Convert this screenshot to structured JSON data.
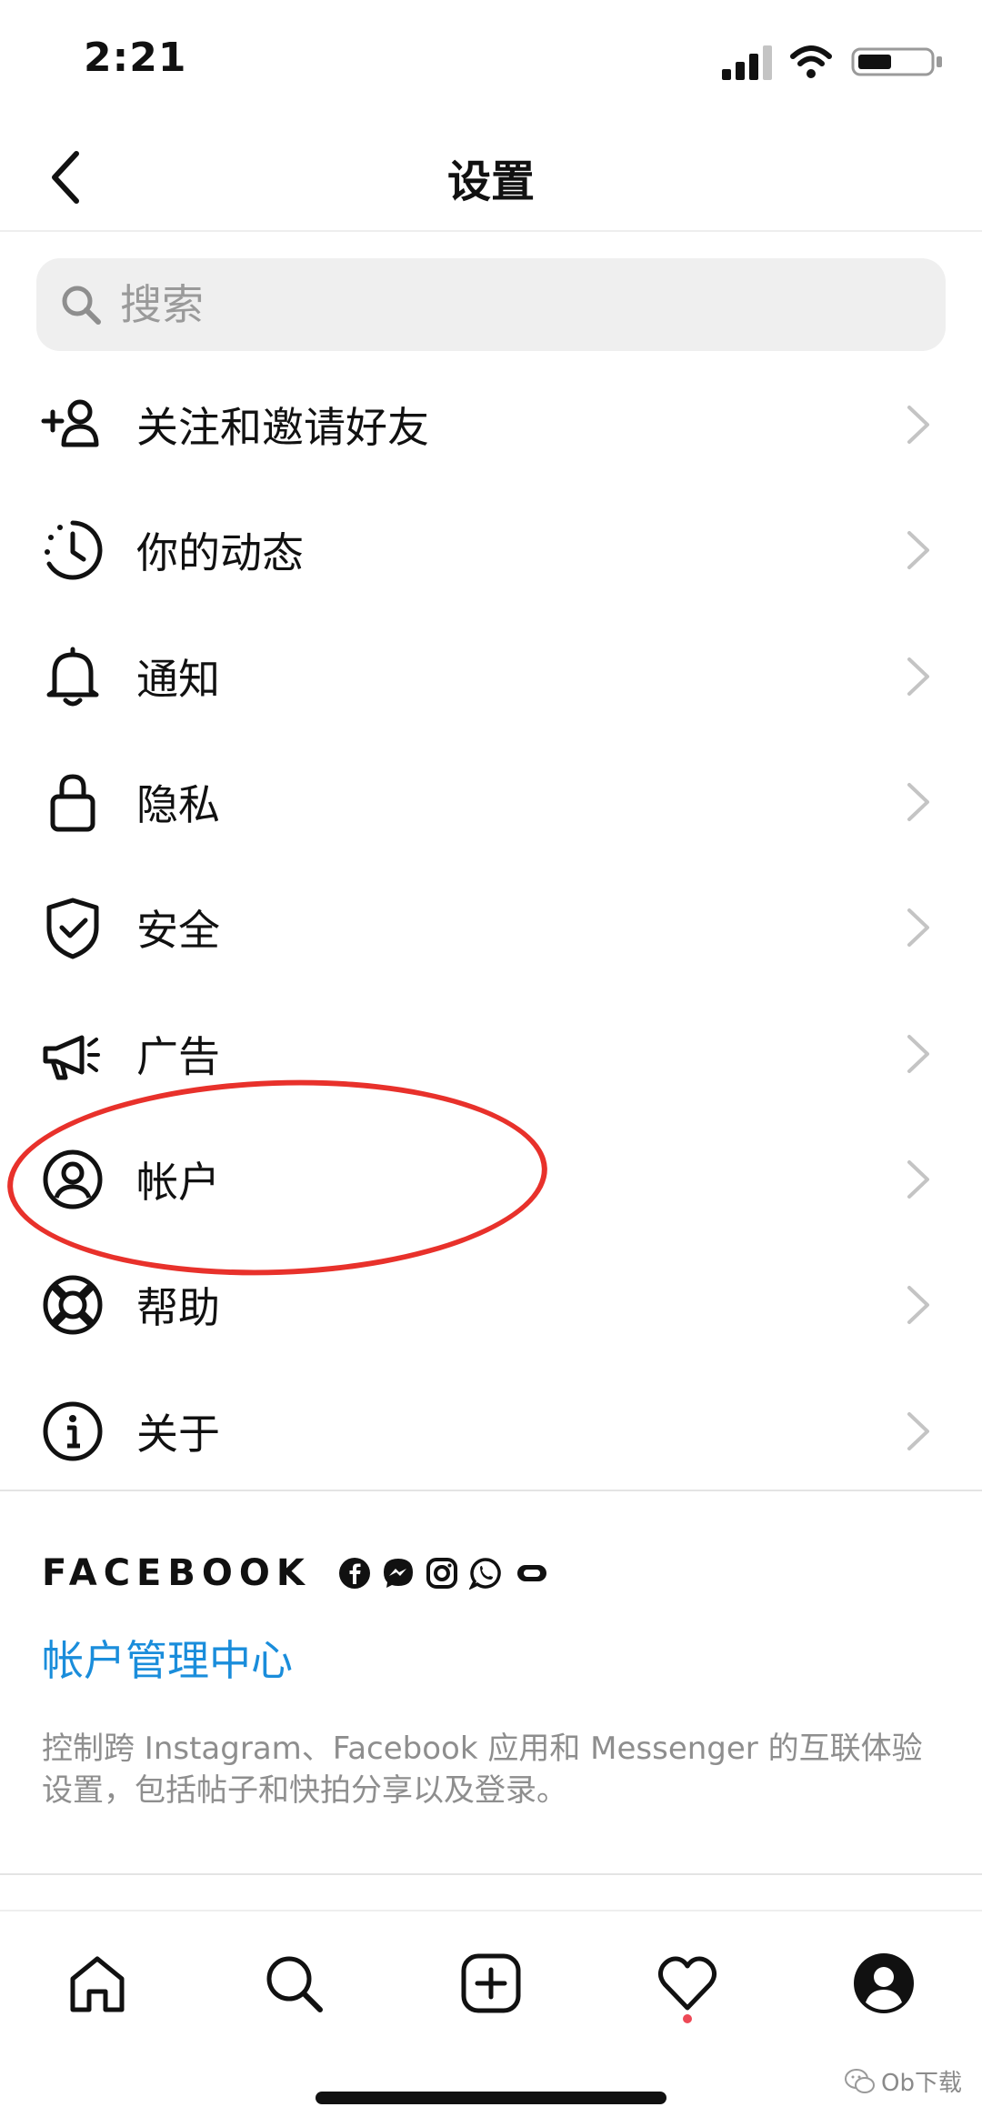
{
  "status_bar": {
    "time": "2:21"
  },
  "header": {
    "title": "设置",
    "back_icon": "chevron-left-icon"
  },
  "search": {
    "placeholder": "搜索",
    "value": ""
  },
  "menu": {
    "items": [
      {
        "label": "关注和邀请好友",
        "icon": "add-person-icon"
      },
      {
        "label": "你的动态",
        "icon": "activity-clock-icon"
      },
      {
        "label": "通知",
        "icon": "bell-icon"
      },
      {
        "label": "隐私",
        "icon": "lock-icon"
      },
      {
        "label": "安全",
        "icon": "shield-check-icon"
      },
      {
        "label": "广告",
        "icon": "megaphone-icon"
      },
      {
        "label": "帐户",
        "icon": "account-circle-icon"
      },
      {
        "label": "帮助",
        "icon": "lifebuoy-icon"
      },
      {
        "label": "关于",
        "icon": "info-icon"
      }
    ]
  },
  "facebook": {
    "wordmark": "FACEBOOK",
    "apps": [
      "facebook-icon",
      "messenger-icon",
      "instagram-icon",
      "whatsapp-icon",
      "oculus-icon"
    ],
    "link_label": "帐户管理中心",
    "description": "控制跨 Instagram、Facebook 应用和 Messenger 的互联体验设置，包括帖子和快拍分享以及登录。"
  },
  "bottom_nav": {
    "items": [
      "home-icon",
      "search-icon",
      "create-icon",
      "activity-heart-icon",
      "profile-icon"
    ]
  },
  "watermark": {
    "text": "Ob下载"
  },
  "colors": {
    "link": "#1a8ddb",
    "annotation": "#e8312b",
    "notification_dot": "#ed4956"
  }
}
